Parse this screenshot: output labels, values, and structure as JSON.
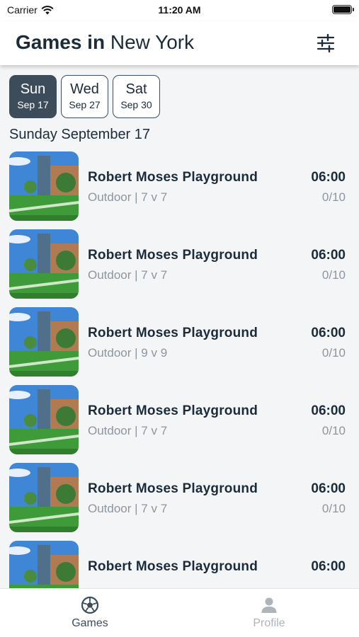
{
  "status_bar": {
    "carrier": "Carrier",
    "time": "11:20 AM"
  },
  "header": {
    "title_strong": "Games in",
    "title_city": "New York"
  },
  "day_tabs": [
    {
      "day": "Sun",
      "date": "Sep 17",
      "selected": true
    },
    {
      "day": "Wed",
      "date": "Sep 27",
      "selected": false
    },
    {
      "day": "Sat",
      "date": "Sep 30",
      "selected": false
    }
  ],
  "section_title": "Sunday September 17",
  "games": [
    {
      "name": "Robert Moses Playground",
      "type": "Outdoor | 7 v 7",
      "time": "06:00",
      "players": "0/10"
    },
    {
      "name": "Robert Moses Playground",
      "type": "Outdoor | 7 v 7",
      "time": "06:00",
      "players": "0/10"
    },
    {
      "name": "Robert Moses Playground",
      "type": "Outdoor | 9 v 9",
      "time": "06:00",
      "players": "0/10"
    },
    {
      "name": "Robert Moses Playground",
      "type": "Outdoor | 7 v 7",
      "time": "06:00",
      "players": "0/10"
    },
    {
      "name": "Robert Moses Playground",
      "type": "Outdoor | 7 v 7",
      "time": "06:00",
      "players": "0/10"
    },
    {
      "name": "Robert Moses Playground",
      "type": "",
      "time": "06:00",
      "players": ""
    }
  ],
  "tab_bar": {
    "games": {
      "label": "Games",
      "icon": "soccer-ball-icon",
      "active": true
    },
    "profile": {
      "label": "Profile",
      "icon": "person-icon",
      "active": false
    }
  },
  "colors": {
    "accent": "#3d4c5b",
    "text": "#1c2b3a",
    "muted": "#8d959e",
    "inactive_tab": "#aeb4ba"
  }
}
